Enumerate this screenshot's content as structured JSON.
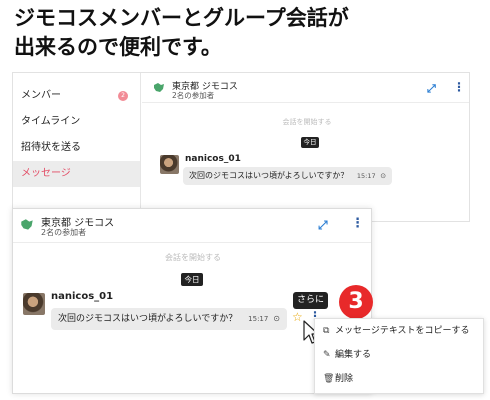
{
  "headline": {
    "line1": "ジモコスメンバーとグループ会話が",
    "line2": "出来るので便利です。"
  },
  "sidebar": {
    "items": [
      {
        "label": "メンバー",
        "badge": "2"
      },
      {
        "label": "タイムライン"
      },
      {
        "label": "招待状を送る"
      },
      {
        "label": "メッセージ"
      }
    ]
  },
  "chat": {
    "group_name": "東京都 ジモコス",
    "participants": "2名の参加者",
    "start_text": "会話を開始する",
    "today": "今日",
    "user": "nanicos_01",
    "message": "次回のジモコスはいつ頃がよろしいですか？",
    "time": "15:17"
  },
  "tooltip": "さらに",
  "step_number": "3",
  "menu": {
    "items": [
      {
        "label": "メッセージテキストをコピーする",
        "icon": "copy-icon"
      },
      {
        "label": "編集する",
        "icon": "pencil-icon"
      },
      {
        "label": "削除",
        "icon": "trash-icon"
      }
    ]
  },
  "colors": {
    "accent_pink": "#e24b64",
    "badge_red": "#e8292a",
    "link_blue": "#2d7fd3",
    "group_icon_green": "#4aa56b"
  }
}
